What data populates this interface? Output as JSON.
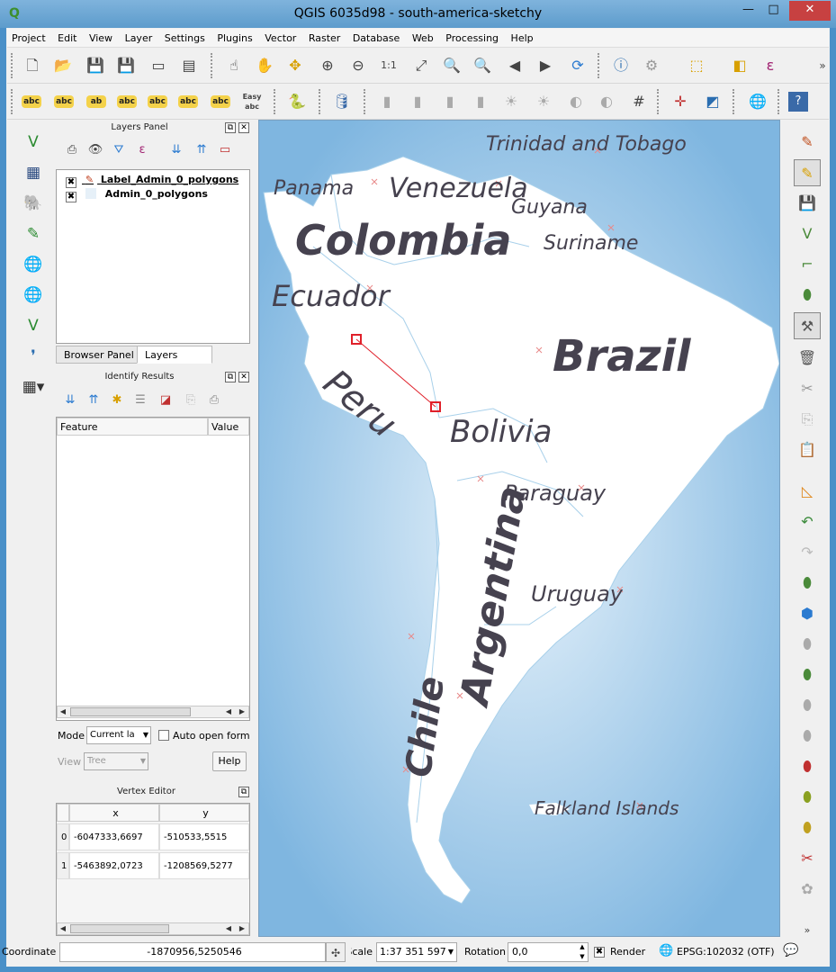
{
  "window": {
    "title": "QGIS 6035d98 - south-america-sketchy",
    "minimize": "—",
    "maximize": "□",
    "close": "✕"
  },
  "menu": [
    "Project",
    "Edit",
    "View",
    "Layer",
    "Settings",
    "Plugins",
    "Vector",
    "Raster",
    "Database",
    "Web",
    "Processing",
    "Help"
  ],
  "layers_panel": {
    "title": "Layers Panel",
    "layers": [
      {
        "name": "Label_Admin_0_polygons",
        "checked": true
      },
      {
        "name": "Admin_0_polygons",
        "checked": true
      }
    ],
    "tabs": [
      "Browser Panel",
      "Layers Panel"
    ]
  },
  "identify_panel": {
    "title": "Identify Results",
    "columns": [
      "Feature",
      "Value"
    ],
    "mode_label": "Mode",
    "mode_value": "Current la",
    "auto_open_form": "Auto open form",
    "view_label": "View",
    "view_value": "Tree",
    "help_button": "Help"
  },
  "vertex_editor": {
    "title": "Vertex Editor",
    "columns": [
      "x",
      "y"
    ],
    "rows": [
      {
        "index": "0",
        "x": "-6047333,6697",
        "y": "-510533,5515"
      },
      {
        "index": "1",
        "x": "-5463892,0723",
        "y": "-1208569,5277"
      }
    ]
  },
  "toolbar": {
    "label_tools": [
      "abc",
      "abc",
      "ab",
      "abc",
      "abc",
      "abc",
      "abc",
      "Easy abc"
    ]
  },
  "map": {
    "labels": [
      {
        "text": "Trinidad and Tobago"
      },
      {
        "text": "Panama"
      },
      {
        "text": "Venezuela"
      },
      {
        "text": "Guyana"
      },
      {
        "text": "Colombia"
      },
      {
        "text": "Suriname"
      },
      {
        "text": "Ecuador"
      },
      {
        "text": "Peru"
      },
      {
        "text": "Brazil"
      },
      {
        "text": "Bolivia"
      },
      {
        "text": "Paraguay"
      },
      {
        "text": "Argentina"
      },
      {
        "text": "Uruguay"
      },
      {
        "text": "Chile"
      },
      {
        "text": "Falkland Islands"
      }
    ],
    "land_color": "#ffffff",
    "sea_color": "#8fbfe3",
    "selection_color": "#e0202a"
  },
  "statusbar": {
    "coordinate_label": "Coordinate",
    "coordinate_value": "-1870956,5250546",
    "scale_label": "Scale",
    "scale_value": "1:37 351 597",
    "rotation_label": "Rotation",
    "rotation_value": "0,0",
    "render_label": "Render",
    "crs": "EPSG:102032 (OTF)"
  }
}
